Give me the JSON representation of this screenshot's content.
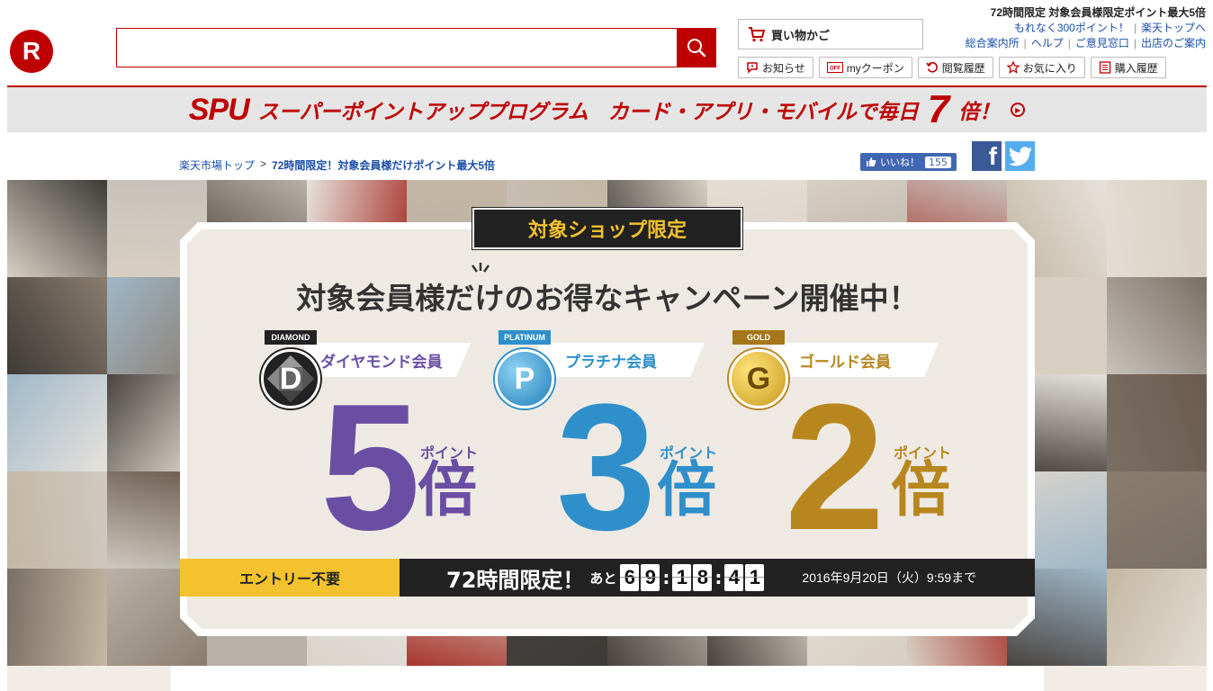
{
  "header": {
    "logo_letter": "R",
    "search": {
      "placeholder": ""
    },
    "cart_label": "買い物かご",
    "promo_text": "72時間限定 対象会員様限定ポイント最大5倍",
    "links_row1": {
      "prize": "もれなく300ポイント！",
      "top": "楽天トップへ"
    },
    "links_row2": {
      "guide": "総合案内所",
      "help": "ヘルプ",
      "opinion": "ご意見窓口",
      "shops": "出店のご案内"
    },
    "nav": {
      "notice": "お知らせ",
      "coupon": "myクーポン",
      "history": "閲覧履歴",
      "favorite": "お気に入り",
      "purchase": "購入履歴"
    }
  },
  "spu_banner": {
    "logo": "SPU",
    "title": "スーパーポイントアッププログラム",
    "subtitle": "カード・アプリ・モバイルで毎日",
    "multiplier": "7",
    "unit": "倍！"
  },
  "breadcrumb": {
    "home": "楽天市場トップ",
    "sep": ">",
    "current": "72時間限定！対象会員様だけポイント最大5倍"
  },
  "social": {
    "like_label": "いいね！",
    "like_count": "155",
    "fb_letter": "f"
  },
  "campaign": {
    "shop_tag": "対象ショップ限定",
    "headline": "対象会員様だけのお得なキャンペーン開催中！",
    "tiers": [
      {
        "badge_text": "DIAMOND",
        "badge_letter": "D",
        "label": "ダイヤモンド会員",
        "number": "5",
        "point_label": "ポイント",
        "unit": "倍",
        "color": "#6a4ea3"
      },
      {
        "badge_text": "PLATINUM",
        "badge_letter": "P",
        "label": "プラチナ会員",
        "number": "3",
        "point_label": "ポイント",
        "unit": "倍",
        "color": "#2f8fca"
      },
      {
        "badge_text": "GOLD",
        "badge_letter": "G",
        "label": "ゴールド会員",
        "number": "2",
        "point_label": "ポイント",
        "unit": "倍",
        "color": "#b8861f"
      }
    ],
    "entry_label": "エントリー不要",
    "timer": {
      "title": "72時間限定！",
      "remaining_label": "あと",
      "hours": [
        "6",
        "9"
      ],
      "minutes": [
        "1",
        "8"
      ],
      "seconds": [
        "4",
        "1"
      ],
      "deadline": "2016年9月20日（火）9:59まで"
    }
  },
  "colors": {
    "brand": "#bf0000",
    "link": "#1a4ea8",
    "yellow": "#f3c22e"
  }
}
